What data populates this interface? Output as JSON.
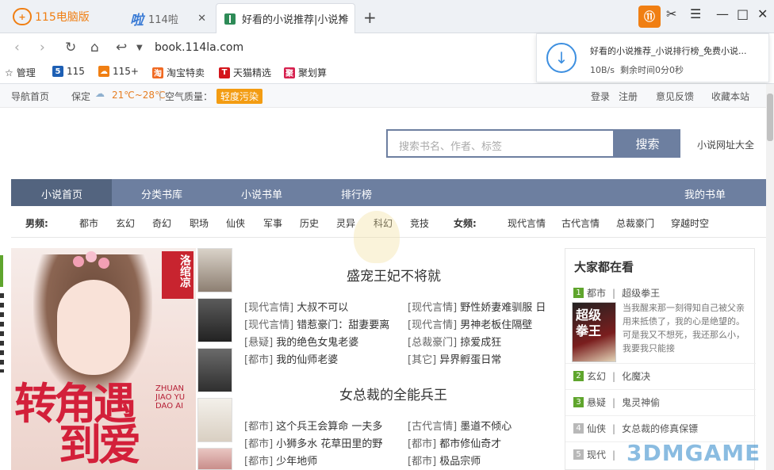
{
  "browser": {
    "brand": "115电脑版",
    "tabs": [
      {
        "label": "114啦",
        "icon": "啦"
      },
      {
        "label": "好看的小说推荐|小说排"
      }
    ],
    "new_tab": "+",
    "url": "book.114la.com",
    "bookmarks": [
      {
        "label": "管理"
      },
      {
        "label": "115",
        "icon": "5",
        "color": "#1d5fb4"
      },
      {
        "label": "115+",
        "color": "#f07f13"
      },
      {
        "label": "淘宝特卖",
        "icon": "淘",
        "color": "#f06a23"
      },
      {
        "label": "天猫精选",
        "icon": "T",
        "color": "#d4151b"
      },
      {
        "label": "聚划算",
        "icon": "聚",
        "color": "#d6204e"
      }
    ],
    "download": {
      "title": "好看的小说推荐_小说排行榜_免费小说...",
      "speed": "10B/s",
      "remaining": "剩余时间0分0秒"
    }
  },
  "site_top": {
    "home": "导航首页",
    "city": "保定",
    "temp": "21℃~28℃",
    "air_label": "空气质量：",
    "air_value": "轻度污染",
    "links": [
      "登录",
      "注册",
      "意见反馈",
      "收藏本站"
    ]
  },
  "search": {
    "placeholder": "搜索书名、作者、标签",
    "button": "搜索",
    "side_link": "小说网址大全"
  },
  "main_nav": {
    "items": [
      "小说首页",
      "分类书库",
      "小说书单",
      "排行榜"
    ],
    "right": "我的书单"
  },
  "categories": {
    "male_label": "男频:",
    "male": [
      "都市",
      "玄幻",
      "奇幻",
      "职场",
      "仙侠",
      "军事",
      "历史",
      "灵异",
      "科幻",
      "竞技"
    ],
    "female_label": "女频:",
    "female": [
      "现代言情",
      "古代言情",
      "总裁豪门",
      "穿越时空"
    ]
  },
  "banner": {
    "title_line1": "转角遇",
    "title_line2": "到爱",
    "seal": "洛绾凉",
    "pinyin": "ZHUAN JIAO YU DAO AI"
  },
  "section1": {
    "title": "盛宠王妃不将就",
    "books": [
      {
        "cat": "[现代言情]",
        "title": "大叔不可以"
      },
      {
        "cat": "[现代言情]",
        "title": "野性娇妻难驯服 日"
      },
      {
        "cat": "[现代言情]",
        "title": "错惹豪门：甜妻要离"
      },
      {
        "cat": "[现代言情]",
        "title": "男神老板住隔壁"
      },
      {
        "cat": "[悬疑]",
        "title": "我的绝色女鬼老婆"
      },
      {
        "cat": "[总裁豪门]",
        "title": "掠爱成狂"
      },
      {
        "cat": "[都市]",
        "title": "我的仙师老婆"
      },
      {
        "cat": "[其它]",
        "title": "异界孵蛋日常"
      }
    ]
  },
  "section2": {
    "title": "女总裁的全能兵王",
    "books": [
      {
        "cat": "[都市]",
        "title": "这个兵王会算命 一夫多"
      },
      {
        "cat": "[古代言情]",
        "title": "墨道不倾心"
      },
      {
        "cat": "[都市]",
        "title": "小狮多水 花草田里的野"
      },
      {
        "cat": "[都市]",
        "title": "都市修仙奇才"
      },
      {
        "cat": "[都市]",
        "title": "少年地师"
      },
      {
        "cat": "[都市]",
        "title": "极品宗师"
      }
    ]
  },
  "right_panel": {
    "title": "大家都在看",
    "top": {
      "num": "1",
      "cat": "都市",
      "title": "超级拳王",
      "desc": "当我醒来那一刻得知自己被父亲用来抵债了，我的心是绝望的。可是我又不想死，我还那么小，我要我只能接"
    },
    "ranks": [
      {
        "num": "2",
        "cat": "玄幻",
        "title": "化魔决"
      },
      {
        "num": "3",
        "cat": "悬疑",
        "title": "鬼灵神偷"
      },
      {
        "num": "4",
        "cat": "仙侠",
        "title": "女总裁的修真保镖"
      },
      {
        "num": "5",
        "cat": "现代"
      }
    ]
  },
  "watermark": "3DMGAME"
}
